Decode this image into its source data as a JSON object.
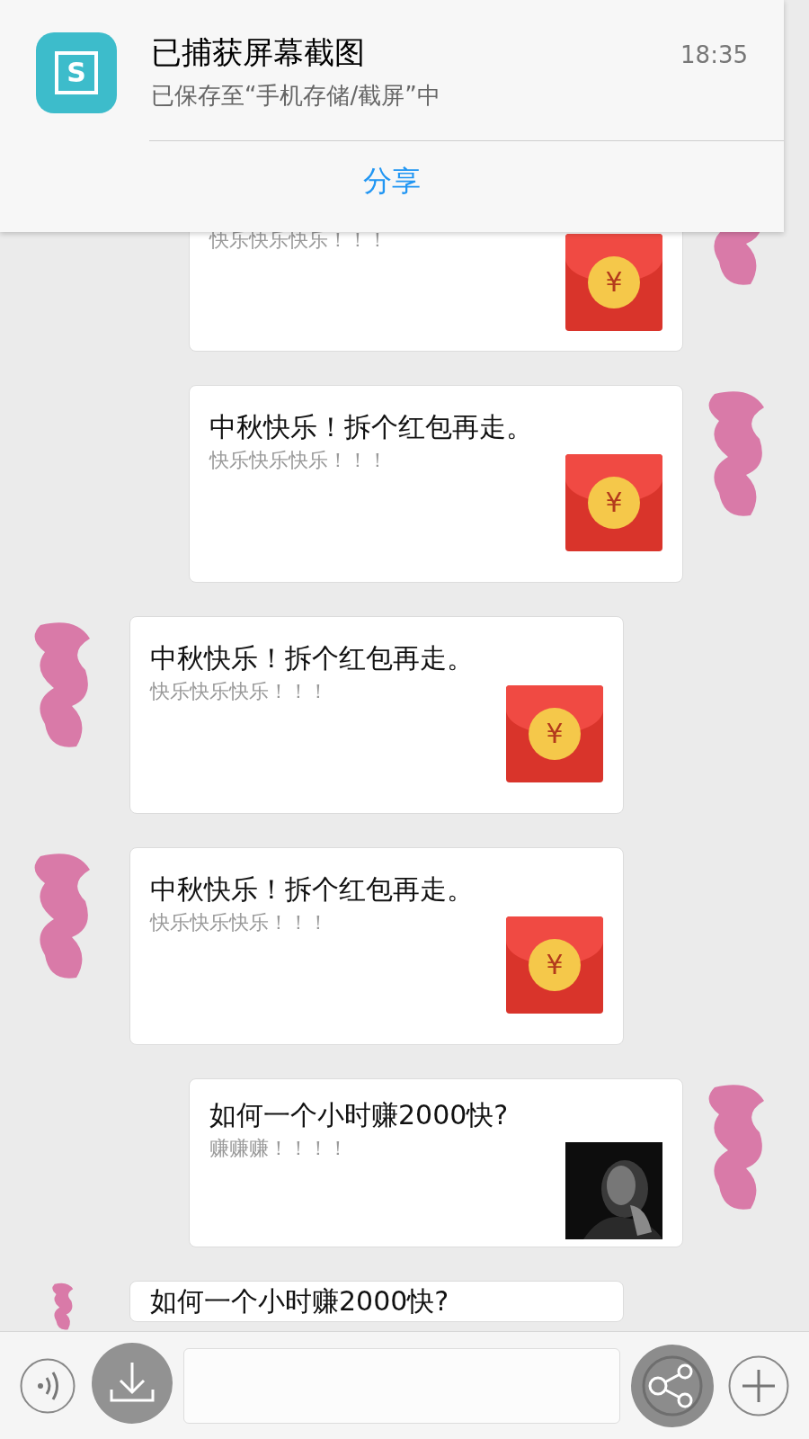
{
  "notification": {
    "app_icon_letter": "S",
    "title": "已捕获屏幕截图",
    "subtitle": "已保存至“手机存储/截屏”中",
    "time": "18:35",
    "action": "分享"
  },
  "messages": [
    {
      "kind": "sent",
      "subtitle": "快乐快乐快乐！！！",
      "attachment": {
        "kind": "red_packet",
        "symbol": "¥"
      }
    },
    {
      "kind": "sent",
      "title": "中秋快乐！拆个红包再走。",
      "subtitle": "快乐快乐快乐！！！",
      "attachment": {
        "kind": "red_packet",
        "symbol": "¥"
      }
    },
    {
      "kind": "received",
      "title": "中秋快乐！拆个红包再走。",
      "subtitle": "快乐快乐快乐！！！",
      "attachment": {
        "kind": "red_packet",
        "symbol": "¥"
      }
    },
    {
      "kind": "received",
      "title": "中秋快乐！拆个红包再走。",
      "subtitle": "快乐快乐快乐！！！",
      "attachment": {
        "kind": "red_packet",
        "symbol": "¥"
      }
    },
    {
      "kind": "sent",
      "title": "如何一个小时赚2000快?",
      "subtitle": "赚赚赚！！！！"
    },
    {
      "kind": "received",
      "title": "如何一个小时赚2000快?"
    }
  ]
}
